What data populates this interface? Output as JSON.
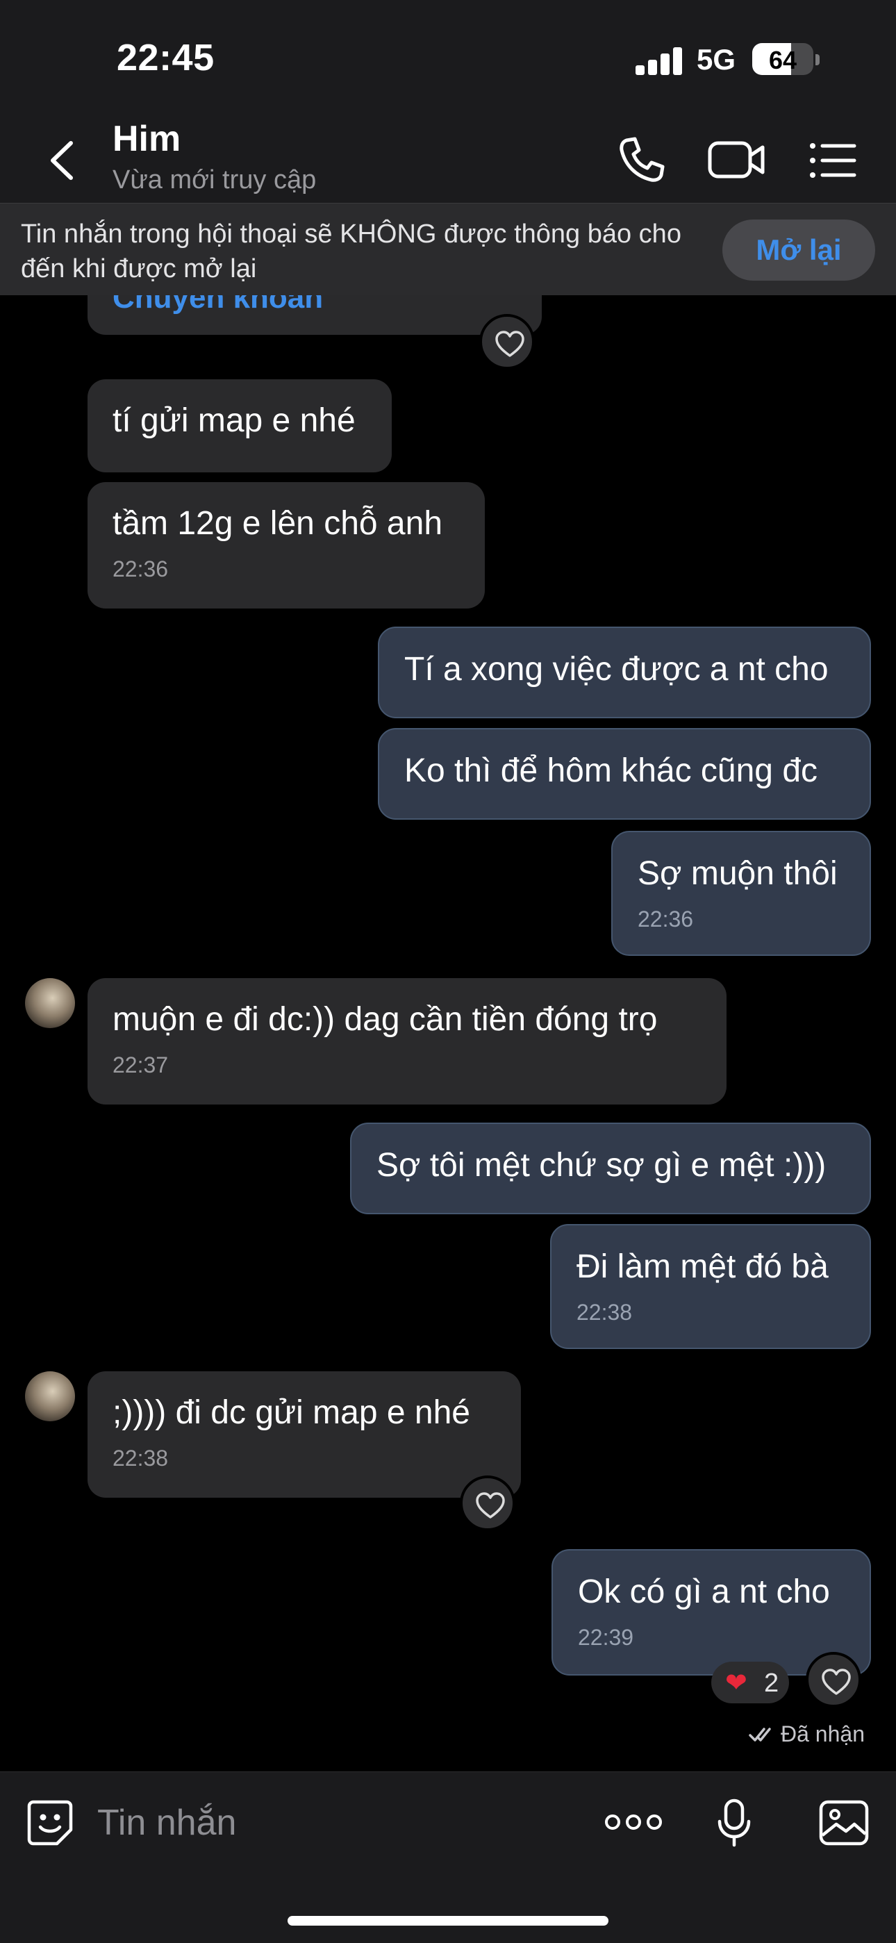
{
  "status_bar": {
    "time": "22:45",
    "network": "5G",
    "battery": "64"
  },
  "header": {
    "contact_name": "Him",
    "presence": "Vừa mới truy cập"
  },
  "banner": {
    "text": "Tin nhắn trong hội thoại sẽ KHÔNG được thông báo cho đến khi được mở lại",
    "reopen_label": "Mở lại"
  },
  "partial_message": {
    "text": "Chuyển khoản"
  },
  "messages": [
    {
      "text": "tí gửi map e nhé"
    },
    {
      "text": "tầm 12g e lên chỗ anh",
      "time": "22:36"
    },
    {
      "text": "Tí a xong việc được a nt cho"
    },
    {
      "text": "Ko thì để hôm khác cũng đc"
    },
    {
      "text": "Sợ muộn thôi",
      "time": "22:36"
    },
    {
      "text": "muộn e đi dc:)) dag cần tiền đóng trọ",
      "time": "22:37"
    },
    {
      "text": "Sợ tôi mệt chứ sợ gì e mệt :)))"
    },
    {
      "text": "Đi làm mệt đó bà",
      "time": "22:38"
    },
    {
      "text": ";)))) đi dc gửi map e nhé",
      "time": "22:38"
    },
    {
      "text": "Ok có gì a nt cho",
      "time": "22:39"
    }
  ],
  "reaction": {
    "emoji": "❤",
    "count": "2"
  },
  "delivery_status": "Đã nhận",
  "composer": {
    "placeholder": "Tin nhắn"
  },
  "icons": {
    "back": "chevron-left-icon",
    "call": "phone-icon",
    "video": "video-camera-icon",
    "menu": "list-icon",
    "heart": "heart-outline-icon",
    "emoji": "emoji-sticker-icon",
    "more": "more-dots-icon",
    "mic": "microphone-icon",
    "image": "image-icon"
  },
  "colors": {
    "accent": "#3f8eea",
    "outgoing_bubble": "#323b4c",
    "incoming_bubble": "#2a2a2c",
    "reaction_heart": "#e8283a"
  }
}
